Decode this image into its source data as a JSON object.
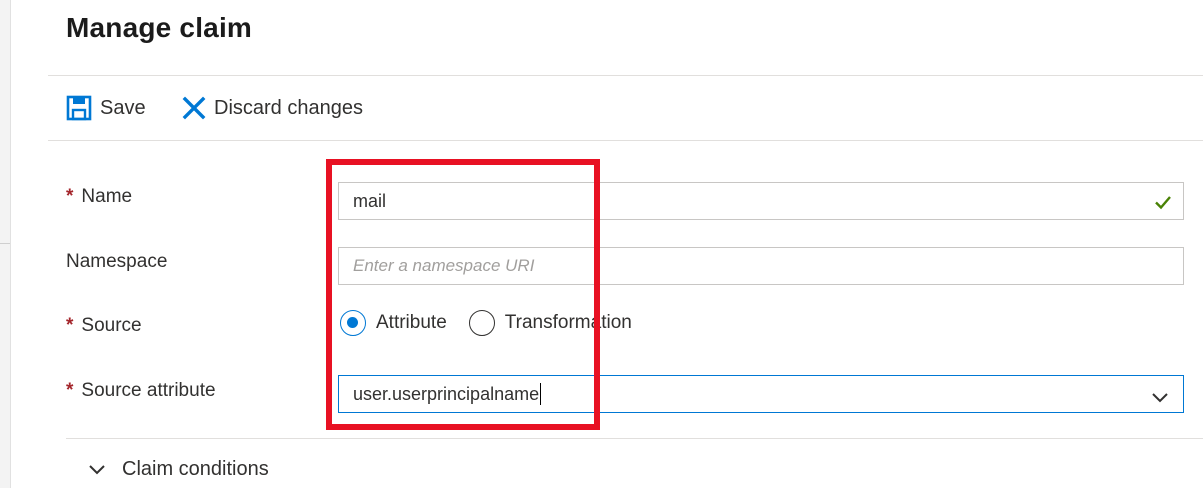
{
  "page": {
    "title": "Manage claim"
  },
  "toolbar": {
    "save_label": "Save",
    "discard_label": "Discard changes"
  },
  "form": {
    "name": {
      "label": "Name",
      "required_marker": "*",
      "value": "mail"
    },
    "namespace": {
      "label": "Namespace",
      "placeholder": "Enter a namespace URI"
    },
    "source": {
      "label": "Source",
      "required_marker": "*",
      "options": [
        "Attribute",
        "Transformation"
      ],
      "selected": "Attribute"
    },
    "source_attribute": {
      "label": "Source attribute",
      "required_marker": "*",
      "value": "user.userprincipalname"
    }
  },
  "sections": {
    "claim_conditions": "Claim conditions"
  },
  "colors": {
    "accent": "#0078d4",
    "required": "#a4262c",
    "valid": "#498205",
    "highlight": "#e81123"
  },
  "icons": [
    "save-icon",
    "close-icon",
    "checkmark-icon",
    "chevron-down-icon"
  ]
}
